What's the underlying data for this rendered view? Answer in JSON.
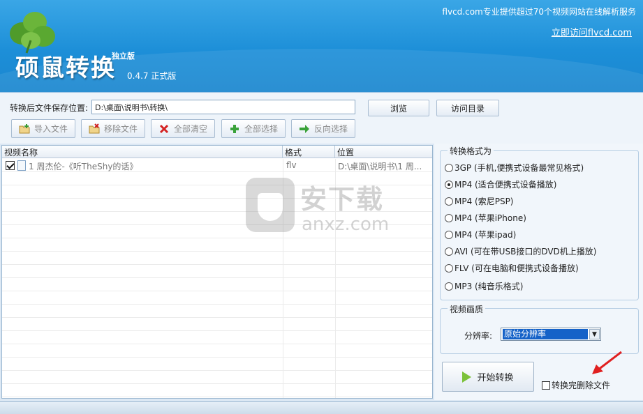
{
  "header": {
    "app_title": "硕鼠转换",
    "edition": "独立版",
    "version": "0.4.7 正式版",
    "slogan": "flvcd.com专业提供超过70个视频网站在线解析服务",
    "visit_link": "立即访问flvcd.com"
  },
  "toolbar": {
    "save_label": "转换后文件保存位置:",
    "save_path": "D:\\桌面\\说明书\\转换\\",
    "browse": "浏览",
    "visit_dir": "访问目录",
    "import": "导入文件",
    "remove": "移除文件",
    "clear_all": "全部清空",
    "select_all": "全部选择",
    "invert": "反向选择"
  },
  "file_table": {
    "columns": [
      "视频名称",
      "格式",
      "位置"
    ],
    "rows": [
      {
        "checked": true,
        "name": "1 周杰伦-《听TheShy的话》",
        "format": "flv",
        "location": "D:\\桌面\\说明书\\1 周..."
      }
    ]
  },
  "format_panel": {
    "title": "转换格式为",
    "options": [
      {
        "label": "3GP (手机,便携式设备最常见格式)",
        "selected": false
      },
      {
        "label": "MP4 (适合便携式设备播放)",
        "selected": true
      },
      {
        "label": "MP4 (索尼PSP)",
        "selected": false
      },
      {
        "label": "MP4 (苹果iPhone)",
        "selected": false
      },
      {
        "label": "MP4 (苹果ipad)",
        "selected": false
      },
      {
        "label": "AVI (可在带USB接口的DVD机上播放)",
        "selected": false
      },
      {
        "label": "FLV (可在电脑和便携式设备播放)",
        "selected": false
      },
      {
        "label": "MP3 (纯音乐格式)",
        "selected": false
      }
    ]
  },
  "quality": {
    "title": "视频画质",
    "resolution_label": "分辨率:",
    "resolution_value": "原始分辨率"
  },
  "actions": {
    "start": "开始转换",
    "delete_after": "转换完删除文件",
    "delete_after_checked": false
  },
  "watermark": {
    "big": "安下载",
    "small": "anxz.com"
  }
}
